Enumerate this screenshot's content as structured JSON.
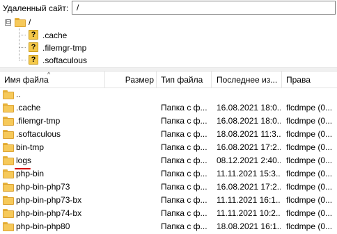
{
  "remote": {
    "label": "Удаленный сайт:",
    "path": "/"
  },
  "tree": {
    "root": {
      "expander": "⊟",
      "label": "/"
    },
    "children": [
      {
        "icon": "?",
        "label": ".cache"
      },
      {
        "icon": "?",
        "label": ".filemgr-tmp"
      },
      {
        "icon": "?",
        "label": ".softaculous"
      }
    ]
  },
  "columns": {
    "name": "Имя файла",
    "sort_indicator": "^",
    "size": "Размер",
    "type": "Тип файла",
    "modified": "Последнее из...",
    "perms": "Права"
  },
  "files": [
    {
      "name": "..",
      "size": "",
      "type": "",
      "modified": "",
      "perms": ""
    },
    {
      "name": ".cache",
      "size": "",
      "type": "Папка с ф...",
      "modified": "16.08.2021 18:0...",
      "perms": "flcdmpe (0..."
    },
    {
      "name": ".filemgr-tmp",
      "size": "",
      "type": "Папка с ф...",
      "modified": "16.08.2021 18:0...",
      "perms": "flcdmpe (0..."
    },
    {
      "name": ".softaculous",
      "size": "",
      "type": "Папка с ф...",
      "modified": "18.08.2021 11:3...",
      "perms": "flcdmpe (0..."
    },
    {
      "name": "bin-tmp",
      "size": "",
      "type": "Папка с ф...",
      "modified": "16.08.2021 17:2...",
      "perms": "flcdmpe (0..."
    },
    {
      "name": "logs",
      "size": "",
      "type": "Папка с ф...",
      "modified": "08.12.2021 2:40...",
      "perms": "flcdmpe (0..."
    },
    {
      "name": "php-bin",
      "size": "",
      "type": "Папка с ф...",
      "modified": "11.11.2021 15:3...",
      "perms": "flcdmpe (0..."
    },
    {
      "name": "php-bin-php73",
      "size": "",
      "type": "Папка с ф...",
      "modified": "16.08.2021 17:2...",
      "perms": "flcdmpe (0..."
    },
    {
      "name": "php-bin-php73-bx",
      "size": "",
      "type": "Папка с ф...",
      "modified": "11.11.2021 16:1...",
      "perms": "flcdmpe (0..."
    },
    {
      "name": "php-bin-php74-bx",
      "size": "",
      "type": "Папка с ф...",
      "modified": "11.11.2021 10:2...",
      "perms": "flcdmpe (0..."
    },
    {
      "name": "php-bin-php80",
      "size": "",
      "type": "Папка с ф...",
      "modified": "18.08.2021 16:1...",
      "perms": "flcdmpe (0..."
    }
  ],
  "highlight": {
    "row": "logs",
    "color": "#d40000"
  }
}
